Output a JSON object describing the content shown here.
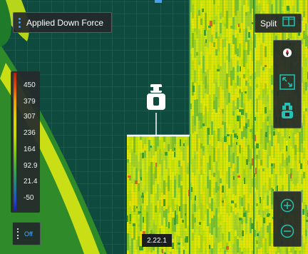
{
  "layer_selector": {
    "label": "Applied Down Force",
    "icon": "grip-dots-icon"
  },
  "split_button": {
    "label": "Split",
    "icon": "split-view-icon"
  },
  "legend": {
    "ticks": [
      "450",
      "379",
      "307",
      "236",
      "164",
      "92.9",
      "21.4",
      "-50"
    ],
    "colors": [
      "#b81f10",
      "#e24a0a",
      "#ef9a06",
      "#e0d200",
      "#84c60e",
      "#3fa840",
      "#1c7e8a",
      "#1c1fa8"
    ]
  },
  "overlay_toggle": {
    "label": "Off"
  },
  "right_toolbar": {
    "buttons": [
      {
        "name": "compass",
        "icon": "compass-icon"
      },
      {
        "name": "fit-to-field",
        "icon": "expand-arrows-icon"
      },
      {
        "name": "center-on-tractor",
        "icon": "tractor-icon"
      }
    ]
  },
  "zoom_controls": {
    "zoom_in_icon": "plus-circle-icon",
    "zoom_out_icon": "minus-circle-icon"
  },
  "version_label": "2.22.1",
  "colors": {
    "grid_background": "#0f4a3f",
    "grid_line": "#2e6b5e",
    "accent": "#22c3b4",
    "panel": "#23282a",
    "coverage_yellow": "#d8e600",
    "coverage_green": "#3f9f2a"
  }
}
